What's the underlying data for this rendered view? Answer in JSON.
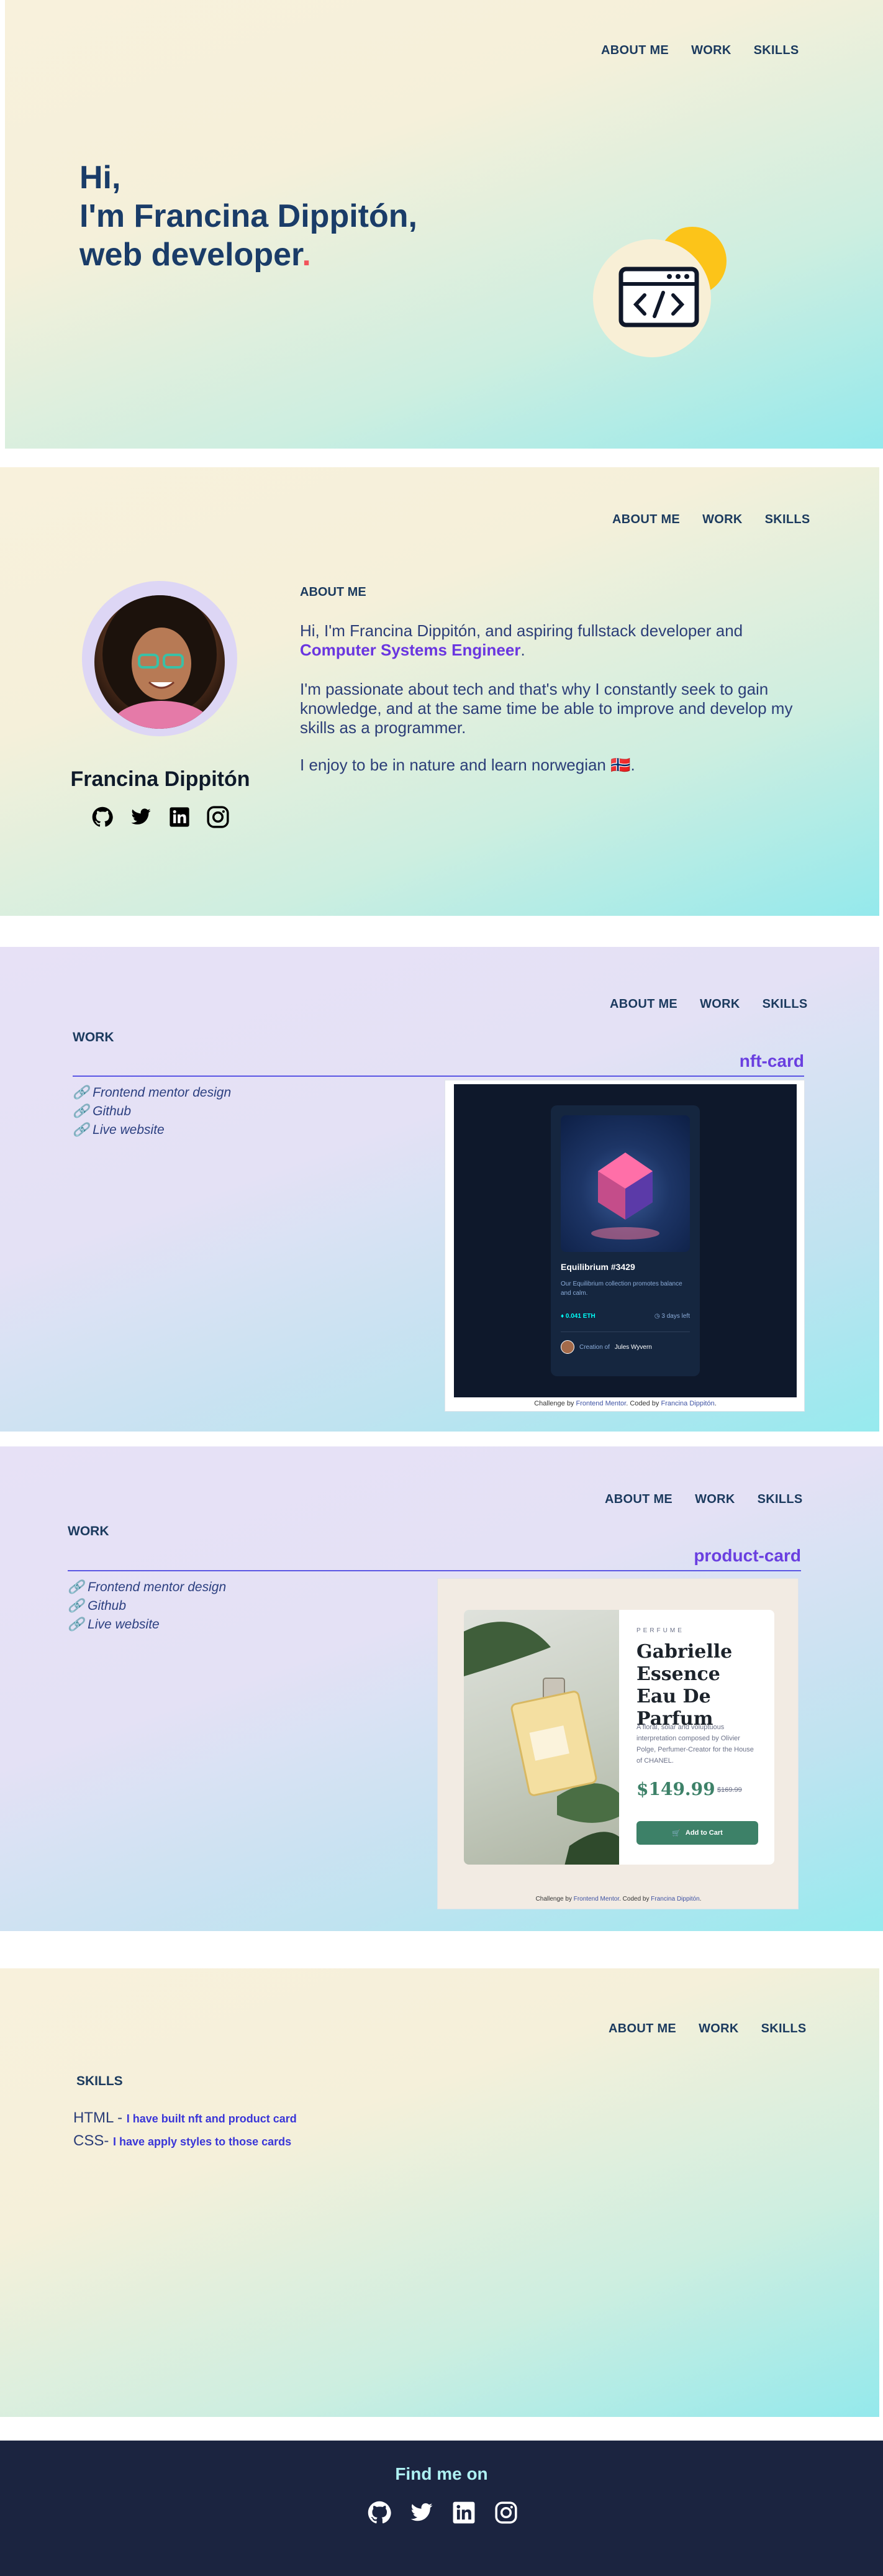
{
  "nav": {
    "about": "ABOUT ME",
    "work": "WORK",
    "skills": "SKILLS"
  },
  "hero": {
    "line1": "Hi,",
    "line2": "I'm Francina Dippitón,",
    "line3": "web developer",
    "dot": "."
  },
  "about": {
    "label": "ABOUT ME",
    "intro_prefix": "Hi, I'm Francina Dippitón, and aspiring fullstack developer and",
    "intro_em": "Computer Systems Engineer",
    "intro_suffix": ".",
    "paragraph2": "I'm passionate about tech and that's why I constantly seek to gain knowledge, and at the same time be able to improve and develop my skills as a programmer.",
    "paragraph3": "I enjoy to be in nature and learn norwegian 🇳🇴.",
    "name": "Francina Dippitón"
  },
  "work_nft": {
    "label": "WORK",
    "title": "nft-card",
    "links": [
      "Frontend mentor design",
      "Github",
      "Live website"
    ],
    "card": {
      "name": "Equilibrium #3429",
      "desc": "Our Equilibrium collection promotes balance and calm.",
      "price": "0.041 ETH",
      "time": "3 days left",
      "creator_prefix": "Creation of",
      "creator": "Jules Wyvern",
      "credit_prefix": "Challenge by",
      "credit_fm": "Frontend Mentor",
      "credit_mid": ". Coded by",
      "credit_author": "Francina Dippitón",
      "credit_end": "."
    }
  },
  "work_product": {
    "label": "WORK",
    "title": "product-card",
    "links": [
      "Frontend mentor design",
      "Github",
      "Live website"
    ],
    "card": {
      "category": "PERFUME",
      "name": "Gabrielle Essence Eau De Parfum",
      "desc": "A floral, solar and voluptuous interpretation composed by Olivier Polge, Perfumer-Creator for the House of CHANEL.",
      "price": "$149.99",
      "old_price": "$169.99",
      "button": "Add to Cart",
      "credit_prefix": "Challenge by",
      "credit_fm": "Frontend Mentor",
      "credit_mid": ". Coded by",
      "credit_author": "Francina Dippitón",
      "credit_end": "."
    }
  },
  "skills": {
    "label": "SKILLS",
    "html_label": "HTML - ",
    "html_note": "I have built nft and product card",
    "css_label": "CSS- ",
    "css_note": "I have apply styles to those cards"
  },
  "footer": {
    "title": "Find me on"
  },
  "icons": [
    "github-icon",
    "twitter-icon",
    "linkedin-icon",
    "instagram-icon",
    "link-icon",
    "code-window-icon"
  ],
  "colors": {
    "accent": "#6a36e0",
    "heading": "#1a3c68",
    "footer_bg": "#1b2440",
    "footer_text": "#aef0f2",
    "dot": "#f2545b"
  }
}
